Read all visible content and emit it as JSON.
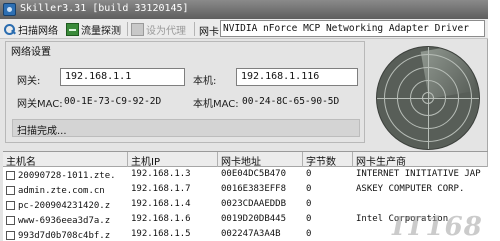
{
  "window": {
    "title": "Skiller3.31 [build 33120145]"
  },
  "toolbar": {
    "scan_label": "扫描网络",
    "flow_label": "流量探测",
    "proxy_label": "设为代理",
    "nic_label": "网卡",
    "nic_value": "NVIDIA nForce MCP Networking Adapter Driver"
  },
  "settings": {
    "group_title": "网络设置",
    "gateway_label": "网关:",
    "gateway_value": "192.168.1.1",
    "local_label": "本机:",
    "local_value": "192.168.1.116",
    "gateway_mac_label": "网关MAC:",
    "gateway_mac_value": "00-1E-73-C9-92-2D",
    "local_mac_label": "本机MAC:",
    "local_mac_value": "00-24-8C-65-90-5D",
    "status": "扫描完成..."
  },
  "table": {
    "columns": [
      "主机名",
      "主机IP",
      "网卡地址",
      "字节数",
      "网卡生产商"
    ],
    "rows": [
      {
        "host": "20090728-1011.zte.",
        "ip": "192.168.1.3",
        "mac": "00E04DC5B470",
        "bytes": "0",
        "vendor": "INTERNET INITIATIVE JAP"
      },
      {
        "host": "admin.zte.com.cn",
        "ip": "192.168.1.7",
        "mac": "0016E383EFF8",
        "bytes": "0",
        "vendor": "ASKEY COMPUTER CORP."
      },
      {
        "host": "pc-200904231420.z",
        "ip": "192.168.1.4",
        "mac": "0023CDAAEDDB",
        "bytes": "0",
        "vendor": ""
      },
      {
        "host": "www-6936eea3d7a.z",
        "ip": "192.168.1.6",
        "mac": "0019D20DB445",
        "bytes": "0",
        "vendor": "Intel Corporation"
      },
      {
        "host": "993d7d0b708c4bf.z",
        "ip": "192.168.1.5",
        "mac": "002247A3A4B",
        "bytes": "0",
        "vendor": ""
      }
    ]
  },
  "watermark": "IT168"
}
